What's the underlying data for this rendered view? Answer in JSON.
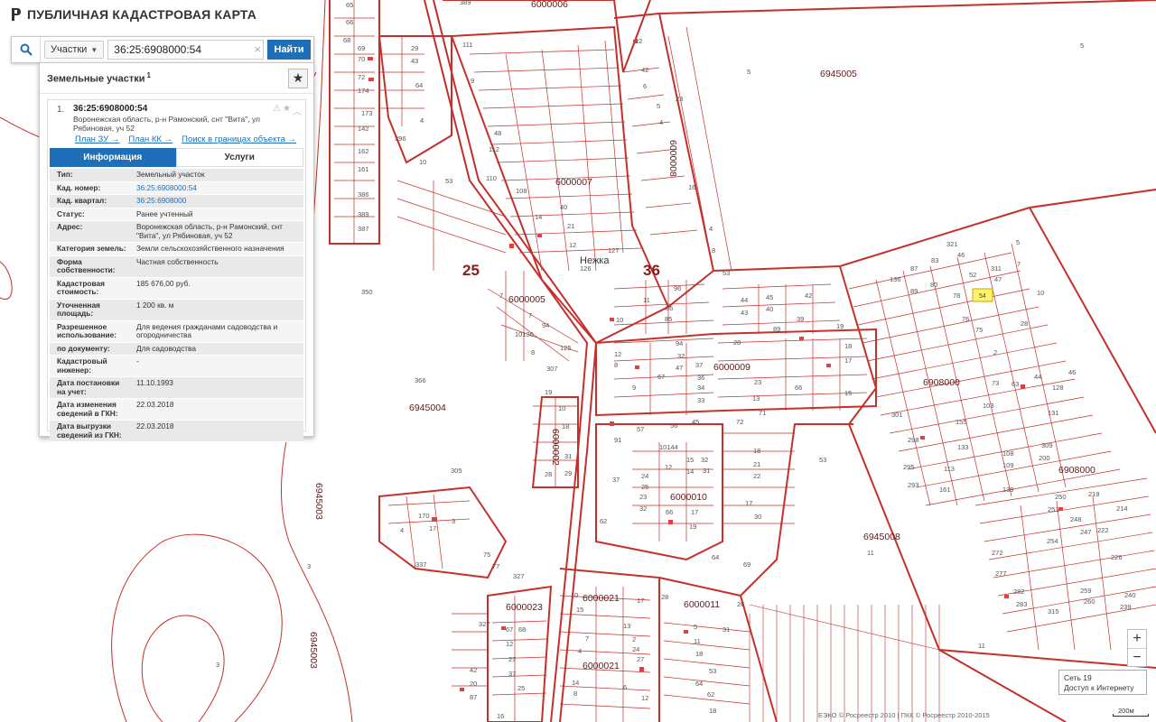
{
  "app": {
    "title": "ПУБЛИЧНАЯ КАДАСТРОВАЯ КАРТА"
  },
  "search": {
    "type_label": "Участки",
    "query": "36:25:6908000:54",
    "clear_symbol": "×",
    "button_label": "Найти"
  },
  "panel": {
    "title": "Земельные участки",
    "count": "1",
    "star_symbol": "★"
  },
  "parcel": {
    "index": "1.",
    "id": "36:25:6908000:54",
    "address": "Воронежская область, р-н Рамонский, снт \"Вита\", ул Рябиновая, уч 52",
    "links": [
      "План ЗУ →",
      "План КК →",
      "Поиск в границах объекта →"
    ],
    "tabs": [
      "Информация",
      "Услуги"
    ],
    "info": [
      {
        "key": "Тип:",
        "value": "Земельный участок"
      },
      {
        "key": "Кад. номер:",
        "value": "36:25:6908000:54"
      },
      {
        "key": "Кад. квартал:",
        "value": "36:25:6908000"
      },
      {
        "key": "Статус:",
        "value": "Ранее учтенный"
      },
      {
        "key": "Адрес:",
        "value": "Воронежская область, р-н Рамонский, снт \"Вита\", ул Рябиновая, уч 52"
      },
      {
        "key": "Категория земель:",
        "value": "Земли сельскохозяйственного назначения"
      },
      {
        "key": "Форма собственности:",
        "value": "Частная собственность"
      },
      {
        "key": "Кадастровая стоимость:",
        "value": "185 676,00 руб."
      },
      {
        "key": "Уточненная площадь:",
        "value": "1 200 кв. м"
      },
      {
        "key": "Разрешенное использование:",
        "value": "Для ведения гражданами садоводства и огородничества"
      },
      {
        "key": "по документу:",
        "value": "Для садоводства"
      },
      {
        "key": "Кадастровый инженер:",
        "value": "-"
      },
      {
        "key": "Дата постановки на учет:",
        "value": "11.10.1993"
      },
      {
        "key": "Дата изменения сведений в ГКН:",
        "value": "22.03.2018"
      },
      {
        "key": "Дата выгрузки сведений из ГКН:",
        "value": "22.03.2018"
      }
    ]
  },
  "map": {
    "big_labels": [
      "25",
      "36"
    ],
    "quarters": [
      "6945005",
      "6000006",
      "6000007",
      "6000008",
      "6000005",
      "6000009",
      "6945004",
      "6000002",
      "6000010",
      "6945003",
      "6000023",
      "6000021",
      "6000011",
      "6945008",
      "6908000",
      "6908000",
      "6000021"
    ],
    "place_name": "Нежка",
    "selected_parcel": "54",
    "colors": {
      "boundary": "#c4302b",
      "selected_fill": "#fff36b",
      "marker": "#e04040"
    }
  },
  "controls": {
    "zoom_in": "+",
    "zoom_out": "−"
  },
  "network": {
    "line1": "Сеть 19",
    "line2": "Доступ к Интернету"
  },
  "copyright": "ЕЭКО © Росреестр 2010 | ПКК © Росреестр 2010-2015",
  "scale": "200м"
}
